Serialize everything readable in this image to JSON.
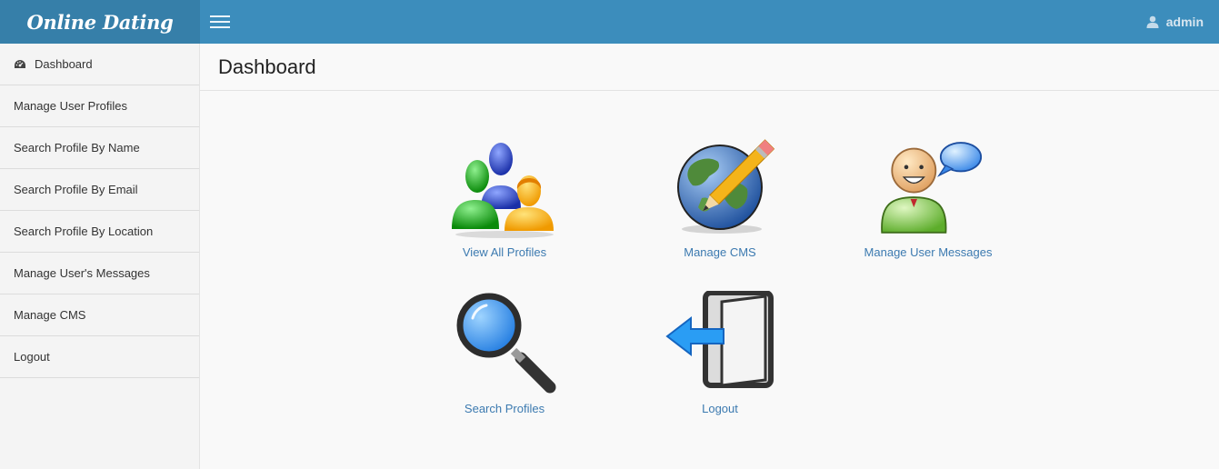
{
  "header": {
    "brand": "Online Dating",
    "user_name": "admin",
    "menu_icon": "hamburger-icon",
    "user_icon": "user-icon"
  },
  "sidebar": {
    "items": [
      {
        "label": "Dashboard",
        "icon": "dashboard-icon"
      },
      {
        "label": "Manage User Profiles"
      },
      {
        "label": "Search Profile By Name"
      },
      {
        "label": "Search Profile By Email"
      },
      {
        "label": "Search Profile By Location"
      },
      {
        "label": "Manage User's Messages"
      },
      {
        "label": "Manage CMS"
      },
      {
        "label": "Logout"
      }
    ]
  },
  "main": {
    "title": "Dashboard",
    "tiles": [
      {
        "label": "View All Profiles",
        "icon": "users-group-icon"
      },
      {
        "label": "Manage CMS",
        "icon": "globe-pencil-icon"
      },
      {
        "label": "Manage User Messages",
        "icon": "user-message-icon"
      },
      {
        "label": "Search Profiles",
        "icon": "magnifier-icon"
      },
      {
        "label": "Logout",
        "icon": "logout-door-icon"
      }
    ]
  },
  "colors": {
    "topbar": "#3c8dbc",
    "brand_bg": "#367fa9",
    "link": "#3c7ab0"
  }
}
